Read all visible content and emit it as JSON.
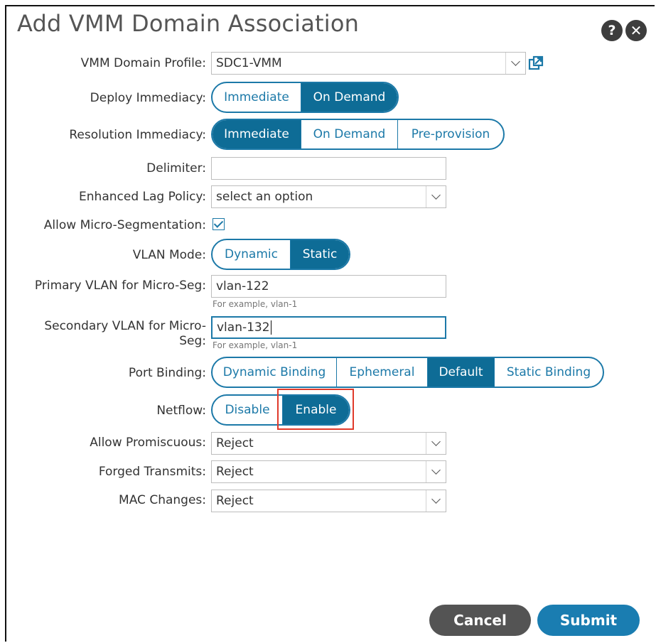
{
  "dialog": {
    "title": "Add VMM Domain Association",
    "help_icon": "?",
    "close_icon": "✕"
  },
  "fields": {
    "vmm_domain_profile": {
      "label": "VMM Domain Profile:",
      "value": "SDC1-VMM"
    },
    "deploy_immediacy": {
      "label": "Deploy Immediacy:",
      "options": [
        "Immediate",
        "On Demand"
      ],
      "selected": "On Demand"
    },
    "resolution_immediacy": {
      "label": "Resolution Immediacy:",
      "options": [
        "Immediate",
        "On Demand",
        "Pre-provision"
      ],
      "selected": "Immediate"
    },
    "delimiter": {
      "label": "Delimiter:",
      "value": ""
    },
    "enhanced_lag_policy": {
      "label": "Enhanced Lag Policy:",
      "value": "select an option"
    },
    "allow_micro_segmentation": {
      "label": "Allow Micro-Segmentation:",
      "checked": true
    },
    "vlan_mode": {
      "label": "VLAN Mode:",
      "options": [
        "Dynamic",
        "Static"
      ],
      "selected": "Static"
    },
    "primary_vlan": {
      "label": "Primary VLAN for Micro-Seg:",
      "value": "vlan-122",
      "hint": "For example, vlan-1"
    },
    "secondary_vlan": {
      "label_line1": "Secondary VLAN for Micro-",
      "label_line2": "Seg:",
      "value": "vlan-132",
      "hint": "For example, vlan-1"
    },
    "port_binding": {
      "label": "Port Binding:",
      "options": [
        "Dynamic Binding",
        "Ephemeral",
        "Default",
        "Static Binding"
      ],
      "selected": "Default"
    },
    "netflow": {
      "label": "Netflow:",
      "options": [
        "Disable",
        "Enable"
      ],
      "selected": "Enable"
    },
    "allow_promiscuous": {
      "label": "Allow Promiscuous:",
      "value": "Reject"
    },
    "forged_transmits": {
      "label": "Forged Transmits:",
      "value": "Reject"
    },
    "mac_changes": {
      "label": "MAC Changes:",
      "value": "Reject"
    }
  },
  "buttons": {
    "cancel": "Cancel",
    "submit": "Submit"
  },
  "colors": {
    "accent": "#1c79a8",
    "selected": "#0e6c96",
    "cancel": "#545454",
    "highlight": "#e03a2b"
  }
}
